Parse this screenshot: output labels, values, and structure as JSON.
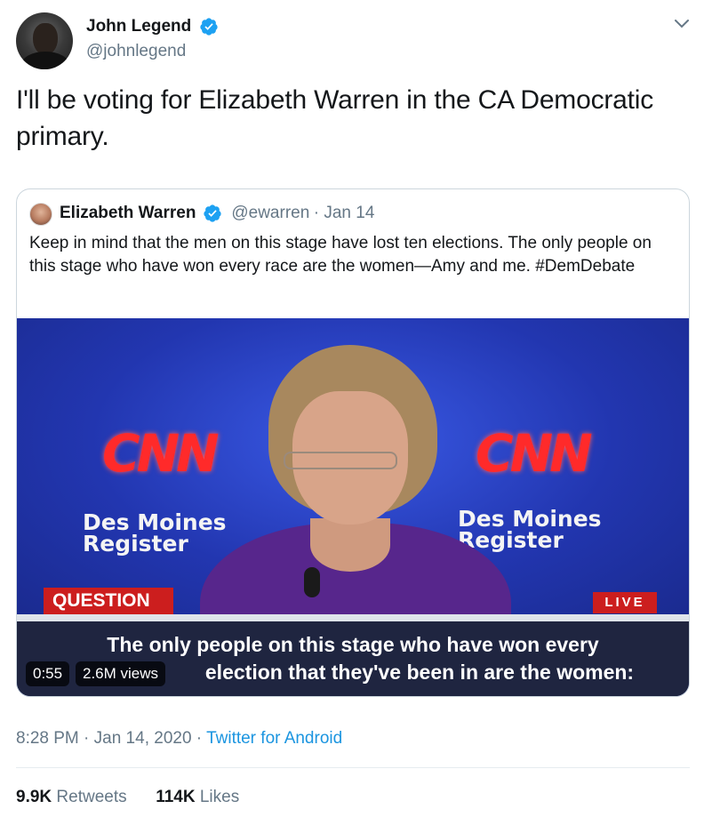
{
  "tweet": {
    "author_name": "John Legend",
    "author_handle": "@johnlegend",
    "verified_icon": "verified-badge-icon",
    "menu_icon": "chevron-down-icon",
    "text": "I'll be voting for Elizabeth Warren in the CA Democratic primary.",
    "timestamp": "8:28 PM · Jan 14, 2020 · ",
    "source": "Twitter for Android",
    "stats": {
      "retweets_count": "9.9K",
      "retweets_label": "Retweets",
      "likes_count": "114K",
      "likes_label": "Likes"
    }
  },
  "quoted_tweet": {
    "author_name": "Elizabeth Warren",
    "author_handle": "@ewarren",
    "date": "· Jan 14",
    "text": "Keep in mind that the men on this stage have lost ten elections. The only people on this stage who have won every race are the women—Amy and me. #DemDebate",
    "video": {
      "logo_left": "CNN",
      "logo_right": "CNN",
      "sponsor_left": "Des Moines\nRegister",
      "sponsor_right": "Des Moines\nRegister",
      "lower_third": "QUESTION",
      "live_badge": "LIVE",
      "caption_line1": "The only people on this stage who have won every",
      "caption_line2": "election that they've been in are the women:",
      "duration": "0:55",
      "views": "2.6M views"
    }
  },
  "colors": {
    "text_primary": "#14171a",
    "text_secondary": "#657786",
    "link": "#1b95e0",
    "verified": "#1da1f2",
    "border": "#ccd6dd",
    "cnn_red": "#cc1e1e"
  }
}
